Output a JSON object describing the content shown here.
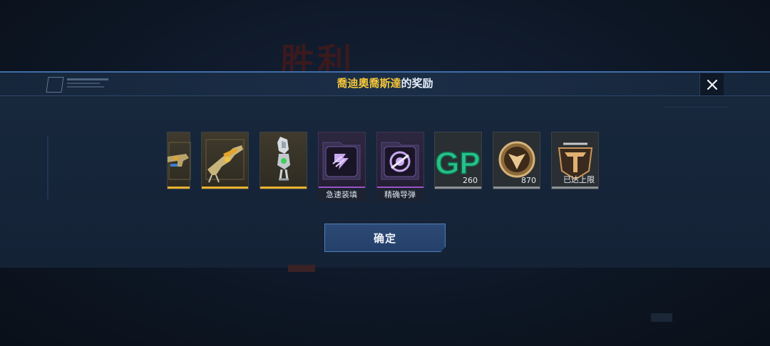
{
  "background": {
    "victory_text": "胜利"
  },
  "dialog": {
    "title_highlight": "喬迪奧喬斯達",
    "title_rest": "的奖励",
    "close_label": "×",
    "confirm_label": "确定"
  },
  "rewards": [
    {
      "name": "weapon-partial",
      "rarity": "gold",
      "icon": "gun-icon"
    },
    {
      "name": "weapon-rifle",
      "rarity": "gold",
      "icon": "rifle-icon"
    },
    {
      "name": "character-figure",
      "rarity": "gold",
      "icon": "character-icon"
    },
    {
      "name": "skill-quick-reload",
      "rarity": "purple",
      "icon": "folder-skill-icon",
      "label": "急速装填"
    },
    {
      "name": "skill-precision-missile",
      "rarity": "purple",
      "icon": "target-skill-icon",
      "label": "精确导弹"
    },
    {
      "name": "currency-gp",
      "rarity": "plain",
      "icon": "gp-icon",
      "count": "260"
    },
    {
      "name": "badge-medal",
      "rarity": "plain",
      "icon": "medal-icon",
      "count": "870"
    },
    {
      "name": "rank-emblem",
      "rarity": "plain",
      "icon": "rank-icon",
      "count": "已达上限"
    }
  ],
  "colors": {
    "gold": "#e9b12e",
    "purple": "#9a54c7",
    "accent": "#f5c63a"
  }
}
